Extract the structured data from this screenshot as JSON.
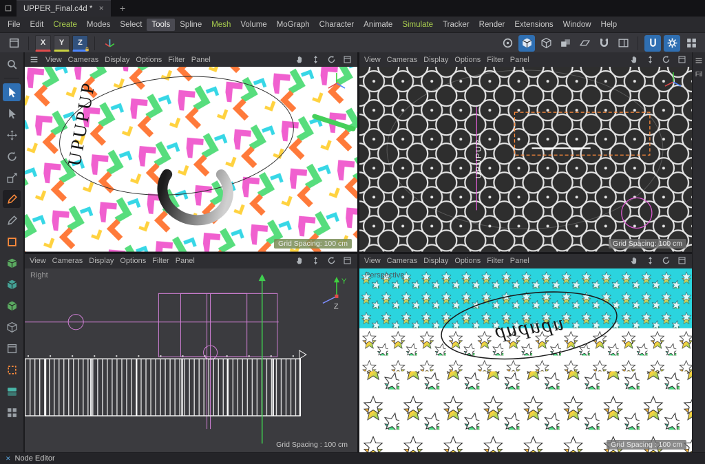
{
  "colors": {
    "accent_blue": "#2f6fb2",
    "menu_green": "#a8cc4e",
    "selection_orange": "#ff8c3c",
    "magenta": "#e05cd5",
    "axis_red": "#e14b4b",
    "axis_green": "#3fd13f",
    "axis_blue": "#4d86ff",
    "viewport_dark_bg": "#2e2e2e",
    "viewport_light_bg": "#ffffff",
    "cyan_selection": "#2bd4de"
  },
  "titlebar": {
    "tab_title": "UPPER_Final.c4d *",
    "close": "✕",
    "new_tab": "+"
  },
  "menubar": {
    "items": [
      "File",
      "Edit",
      "Create",
      "Modes",
      "Select",
      "Tools",
      "Spline",
      "Mesh",
      "Volume",
      "MoGraph",
      "Character",
      "Animate",
      "Simulate",
      "Tracker",
      "Render",
      "Extensions",
      "Window",
      "Help"
    ]
  },
  "toolbar": {
    "axis_x": "X",
    "axis_y": "Y",
    "axis_z": "Z",
    "icons": [
      "viewport-layout",
      "lock-x",
      "lock-y",
      "lock-z",
      "coordinate-system",
      "render-view",
      "model-mode",
      "object-mode",
      "texture-mode",
      "instance-mode",
      "axis-mode",
      "snap-toggle",
      "layout-split",
      "capsule-simulate",
      "settings-gear",
      "layout-grid"
    ]
  },
  "left_toolbar": {
    "icons": [
      "search",
      "live-selection",
      "selection",
      "move",
      "rotate",
      "scale",
      "pen-active",
      "pen",
      "spline-square",
      "cube-green-1",
      "cube-green-2",
      "cube-green-3",
      "cube-outline",
      "frame",
      "dashed-square",
      "layers",
      "grid"
    ]
  },
  "viewport_menu": [
    "View",
    "Cameras",
    "Display",
    "Options",
    "Filter",
    "Panel"
  ],
  "viewport_header_icons": [
    "pan-hand",
    "dolly-updown",
    "orbit-rotate",
    "toggle-fullscreen"
  ],
  "viewports": {
    "top_left": {
      "pattern_text": "UPUPUP",
      "grid_spacing": "Grid Spacing: 100 cm"
    },
    "top_right": {
      "edge_text": "UPUPUP",
      "grid_spacing": "Grid Spacing: 100 cm"
    },
    "bottom_left": {
      "label": "Right",
      "axis_y": "Y",
      "axis_z": "Z",
      "grid_spacing": "Grid Spacing : 100 cm"
    },
    "bottom_right": {
      "label": "Perspective",
      "ellipse_text": "upupup",
      "grid_spacing": "Grid Spacing : 100 cm"
    }
  },
  "right_panel": {
    "label": "Fil"
  },
  "statusbar": {
    "close": "✕",
    "node_editor_label": "Node Editor"
  }
}
